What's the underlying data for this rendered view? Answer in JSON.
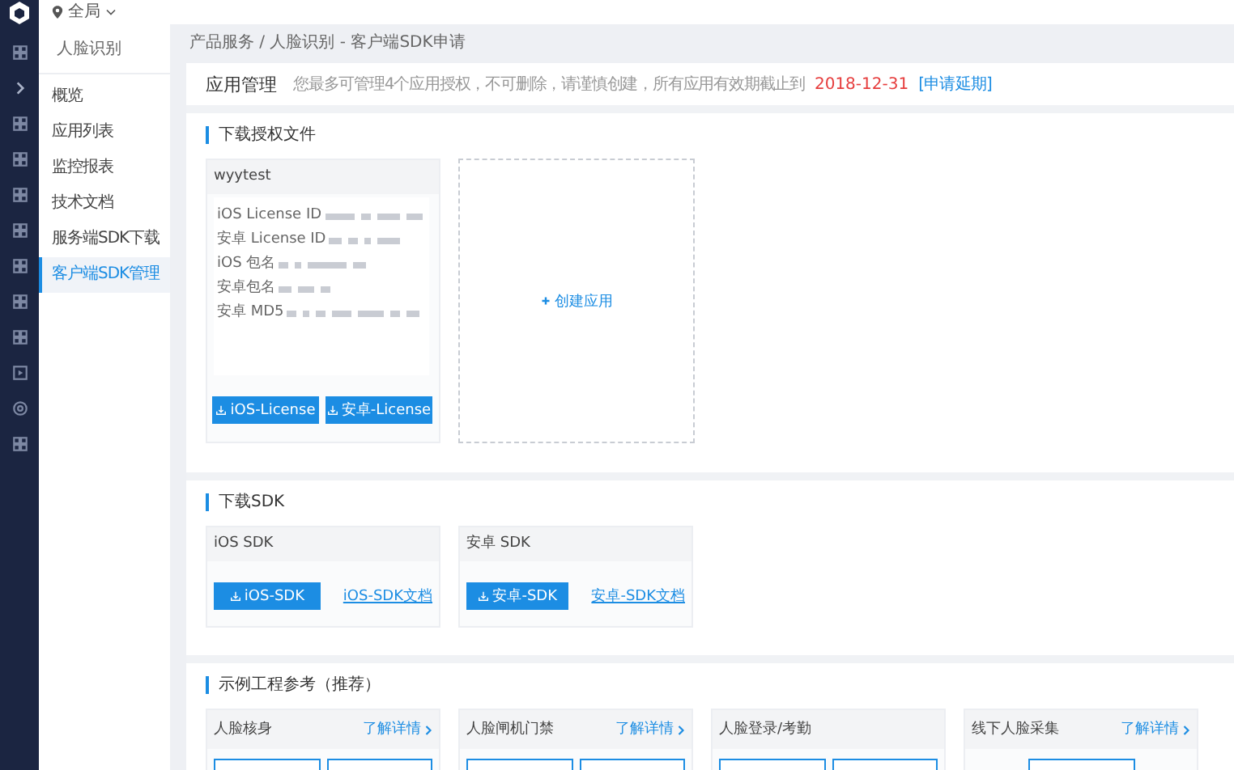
{
  "topbar": {
    "region": "全局"
  },
  "menu": {
    "title": "人脸识别",
    "items": [
      {
        "label": "概览",
        "selected": false
      },
      {
        "label": "应用列表",
        "selected": false
      },
      {
        "label": "监控报表",
        "selected": false
      },
      {
        "label": "技术文档",
        "selected": false
      },
      {
        "label": "服务端SDK下载",
        "selected": false
      },
      {
        "label": "客户端SDK管理",
        "selected": true
      }
    ]
  },
  "breadcrumb": "产品服务 / 人脸识别 - 客户端SDK申请",
  "header": {
    "title": "应用管理",
    "note": "您最多可管理4个应用授权，不可删除，请谨慎创建，所有应用有效期截止到",
    "date": "2018-12-31",
    "link": "[申请延期]"
  },
  "license_section": {
    "title": "下载授权文件",
    "app": {
      "name": "wyytest",
      "fields": [
        {
          "label": "iOS License ID"
        },
        {
          "label": "安卓 License ID"
        },
        {
          "label": "iOS 包名"
        },
        {
          "label": "安卓包名"
        },
        {
          "label": "安卓 MD5"
        }
      ],
      "buttons": [
        "iOS-License",
        "安卓-License"
      ]
    },
    "create": "创建应用"
  },
  "sdk_section": {
    "title": "下载SDK",
    "cards": [
      {
        "title": "iOS SDK",
        "button": "iOS-SDK",
        "link": "iOS-SDK文档"
      },
      {
        "title": "安卓 SDK",
        "button": "安卓-SDK",
        "link": "安卓-SDK文档"
      }
    ]
  },
  "examples_section": {
    "title": "示例工程参考（推荐）",
    "cards": [
      {
        "title": "人脸核身",
        "link": "了解详情",
        "buttons": [
          {
            "kind": "outline"
          },
          {
            "kind": "outline"
          }
        ]
      },
      {
        "title": "人脸闸机门禁",
        "link": "了解详情",
        "buttons": [
          {
            "kind": "outline"
          },
          {
            "kind": "outline"
          }
        ]
      },
      {
        "title": "人脸登录/考勤",
        "buttons": [
          {
            "kind": "outline"
          },
          {
            "kind": "outline"
          }
        ]
      },
      {
        "title": "线下人脸采集",
        "link": "了解详情",
        "buttons": [
          {
            "kind": "outline"
          }
        ]
      }
    ]
  }
}
